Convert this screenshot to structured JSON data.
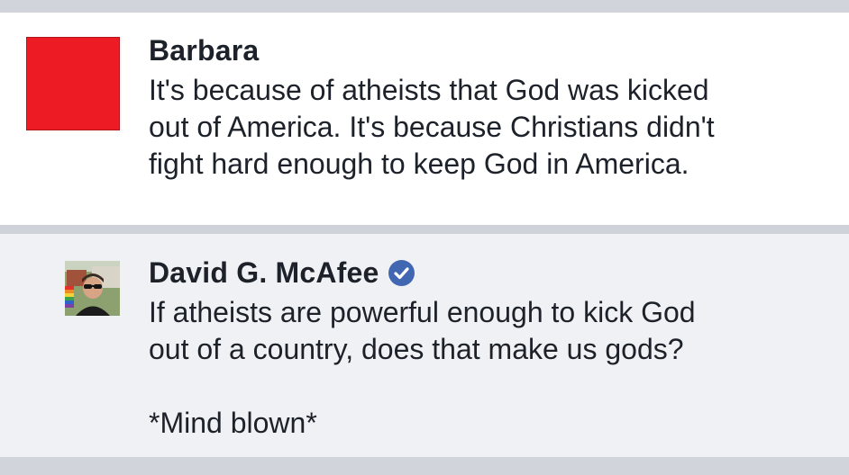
{
  "comment": {
    "author": "Barbara",
    "text_line1": "It's because of atheists that God was kicked",
    "text_line2": "out of America. It's because Christians didn't",
    "text_line3": "fight hard enough to keep God in America.",
    "avatar_color": "#ed1c24"
  },
  "reply": {
    "author": "David G. McAfee",
    "verified": true,
    "text_line1": "If atheists are powerful enough to kick God",
    "text_line2": "out of a country, does that make us gods?",
    "text_line3": "*Mind blown*",
    "verified_color": "#4267b2"
  }
}
